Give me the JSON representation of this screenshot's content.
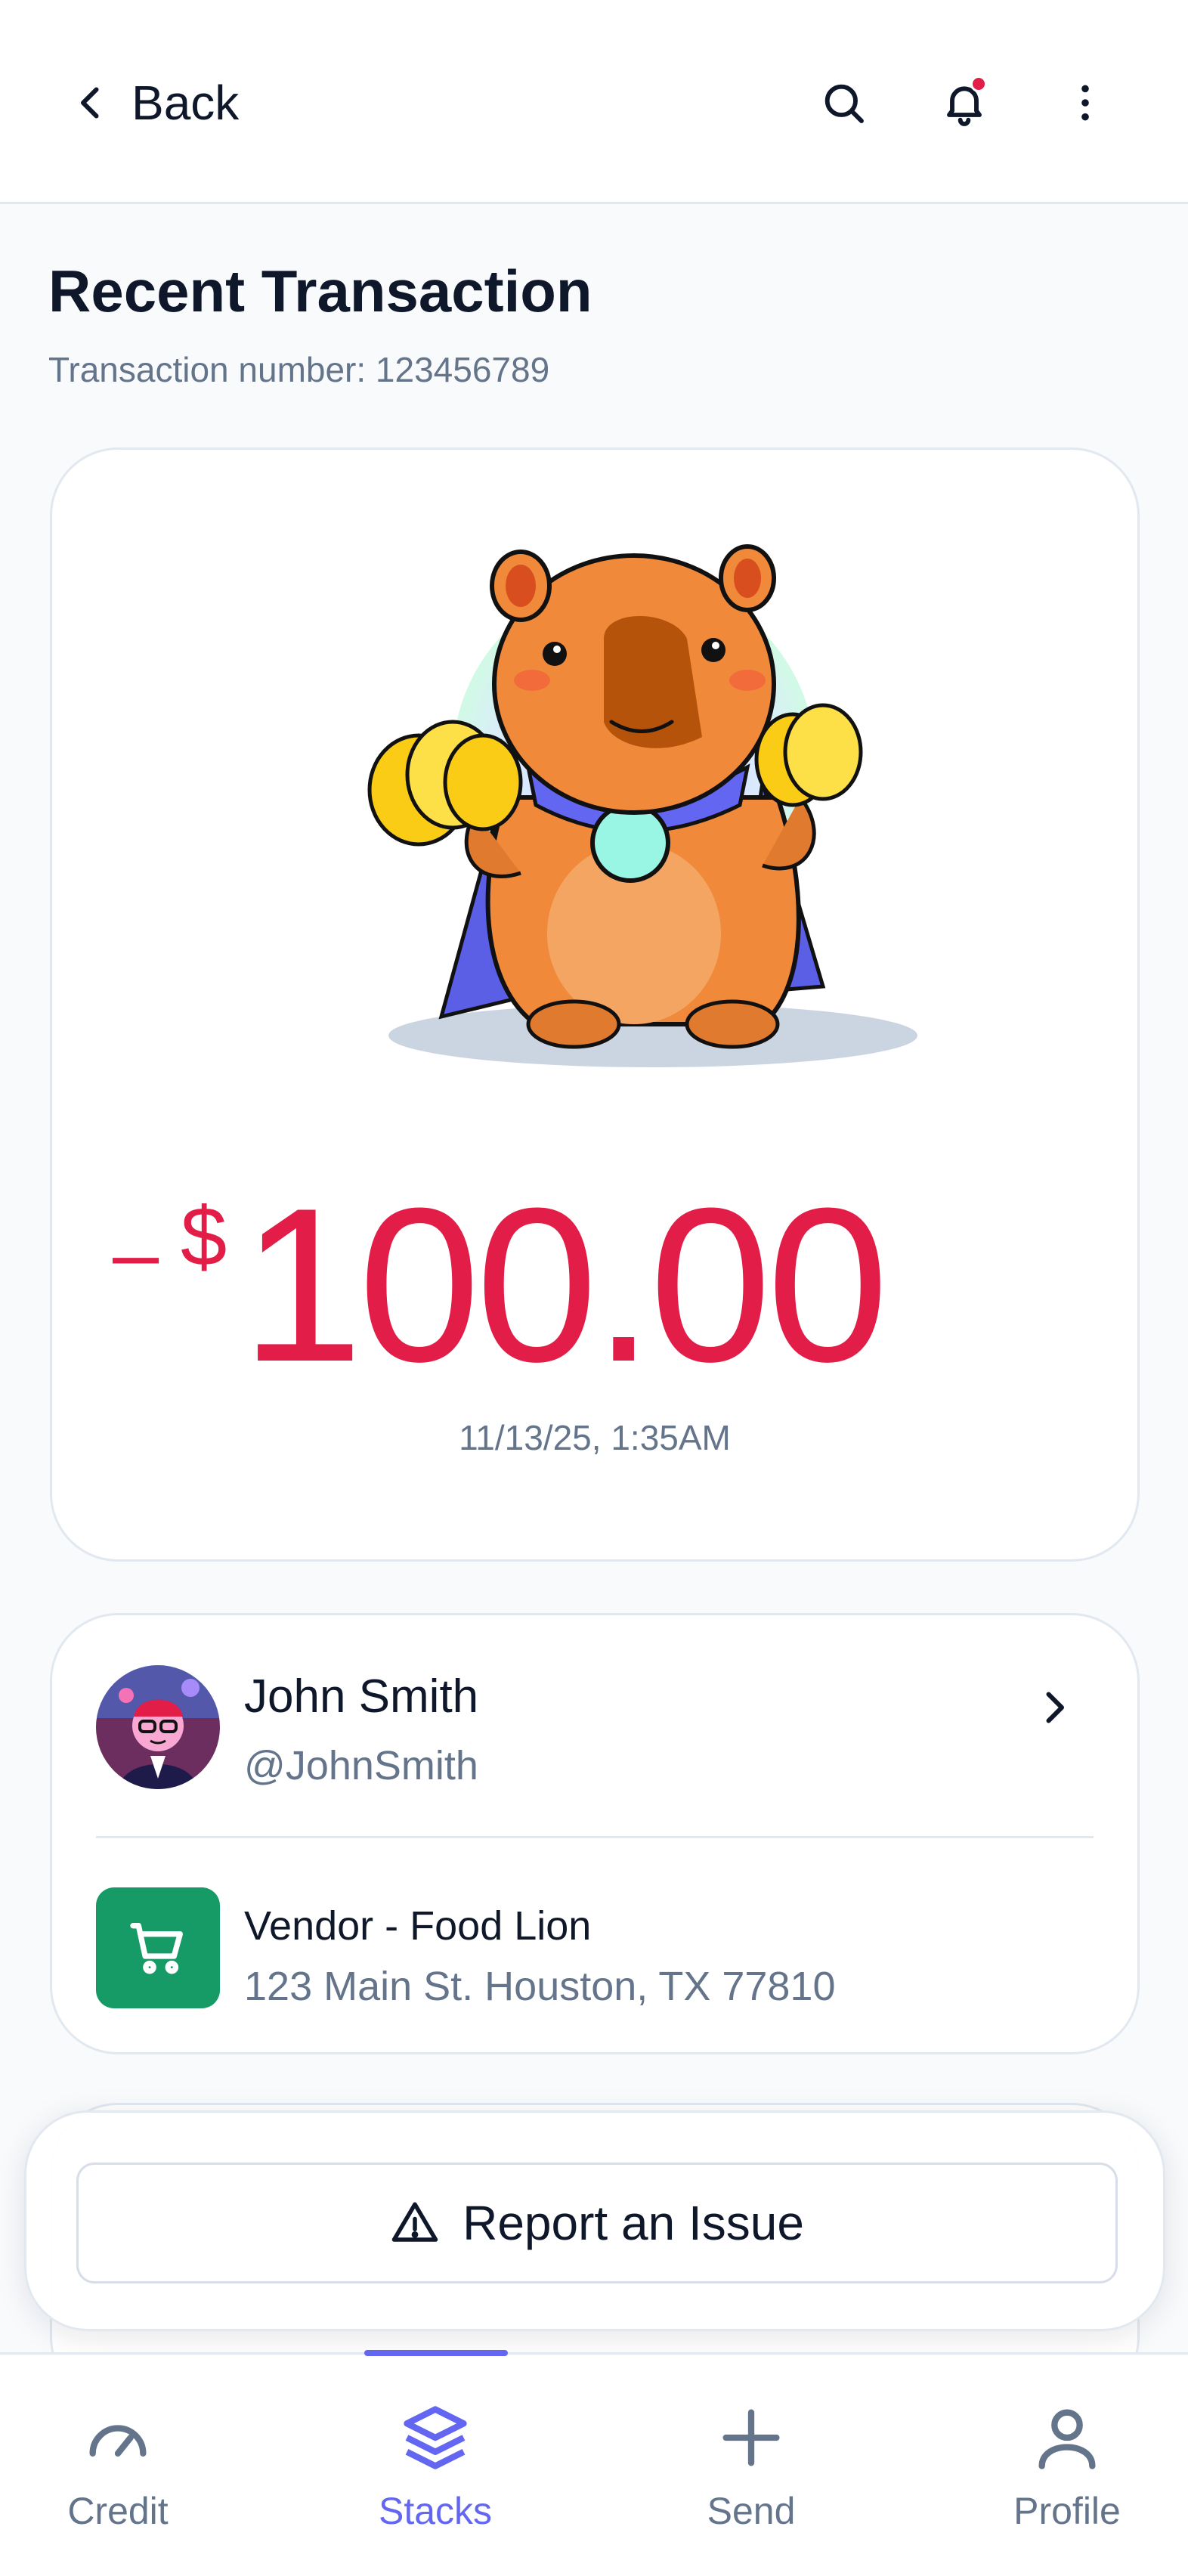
{
  "header": {
    "back_label": "Back",
    "has_notification": true
  },
  "page": {
    "title": "Recent Transaction",
    "subtitle": "Transaction number: 123456789"
  },
  "transaction": {
    "sign": "–",
    "currency": "$",
    "amount": "100.00",
    "datetime": "11/13/25, 1:35AM",
    "amount_color": "#E11D48"
  },
  "counterparty": {
    "name": "John Smith",
    "handle": "@JohnSmith"
  },
  "vendor": {
    "name": "Vendor - Food Lion",
    "address": "123 Main St. Houston, TX 77810",
    "icon_color": "#169A66"
  },
  "actions": {
    "report_label": "Report an Issue"
  },
  "nav": {
    "items": [
      {
        "label": "Credit",
        "icon": "gauge-icon",
        "active": false
      },
      {
        "label": "Stacks",
        "icon": "layers-icon",
        "active": true
      },
      {
        "label": "Send",
        "icon": "plus-icon",
        "active": false
      },
      {
        "label": "Profile",
        "icon": "user-icon",
        "active": false
      }
    ],
    "accent": "#6366F1"
  }
}
